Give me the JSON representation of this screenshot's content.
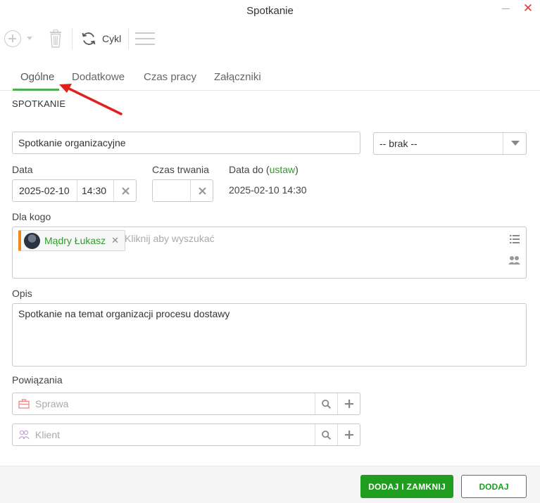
{
  "window": {
    "title": "Spotkanie"
  },
  "toolbar": {
    "cykl_label": "Cykl"
  },
  "tabs": [
    {
      "label": "Ogólne",
      "active": true
    },
    {
      "label": "Dodatkowe"
    },
    {
      "label": "Czas pracy"
    },
    {
      "label": "Załączniki"
    }
  ],
  "form": {
    "section_title": "SPOTKANIE",
    "subject_value": "Spotkanie organizacyjne",
    "category_value": "-- brak --",
    "date_label": "Data",
    "date_value": "2025-02-10",
    "time_value": "14:30",
    "duration_label": "Czas trwania",
    "duration_value": "",
    "date_to_label": "Data do (",
    "date_to_link": "ustaw",
    "date_to_close": ")",
    "date_to_value": "2025-02-10 14:30",
    "for_whom_label": "Dla kogo",
    "for_whom_chip": "Mądry Łukasz",
    "for_whom_placeholder": "Kliknij aby wyszukać",
    "description_label": "Opis",
    "description_value": "Spotkanie na temat organizacji procesu dostawy",
    "relations_label": "Powiązania",
    "case_placeholder": "Sprawa",
    "client_placeholder": "Klient"
  },
  "footer": {
    "add_close_label": "DODAJ I ZAMKNIJ",
    "add_label": "DODAJ"
  },
  "colors": {
    "accent_green": "#1f9d1f",
    "tab_underline": "#4caf50",
    "chip_marker": "#f08a1c",
    "close_red": "#e53935",
    "annotation_arrow": "#e0201c"
  }
}
